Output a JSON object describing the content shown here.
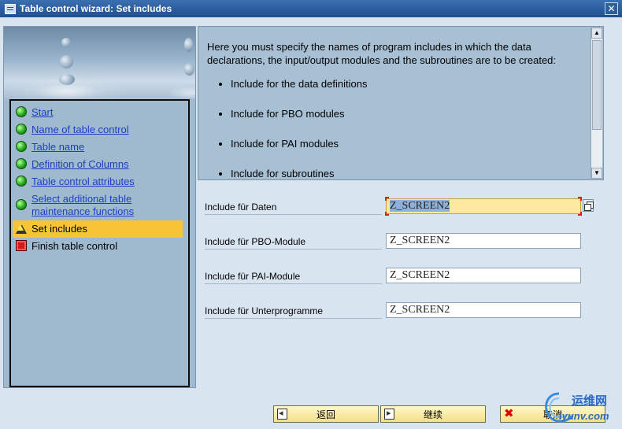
{
  "window": {
    "title": "Table control wizard: Set includes",
    "close_symbol": "✕"
  },
  "steps": [
    {
      "label": "Start",
      "status": "done",
      "icon": "green-light-icon"
    },
    {
      "label": "Name of table control",
      "status": "done",
      "icon": "green-light-icon"
    },
    {
      "label": "Table name",
      "status": "done",
      "icon": "green-light-icon"
    },
    {
      "label": "Definition of Columns",
      "status": "done",
      "icon": "green-light-icon"
    },
    {
      "label": "Table control attributes",
      "status": "done",
      "icon": "green-light-icon"
    },
    {
      "label": "Select additional table maintenance functions",
      "status": "done",
      "icon": "green-light-icon"
    },
    {
      "label": "Set includes",
      "status": "current",
      "icon": "warning-triangle-icon"
    },
    {
      "label": "Finish table control",
      "status": "pending",
      "icon": "red-square-icon"
    }
  ],
  "info": {
    "intro": "Here you must specify the names of program includes in which the data declarations, the input/output modules and the subroutines are to be created:",
    "bullets": [
      "Include for the data definitions",
      "Include for PBO modules",
      "Include for PAI modules",
      "Include for subroutines"
    ]
  },
  "form": {
    "fields": [
      {
        "label": "Include für Daten",
        "value": "Z_SCREEN2"
      },
      {
        "label": "Include für PBO-Module",
        "value": "Z_SCREEN2"
      },
      {
        "label": "Include für PAI-Module",
        "value": "Z_SCREEN2"
      },
      {
        "label": "Include für Unterprogramme",
        "value": "Z_SCREEN2"
      }
    ]
  },
  "buttons": {
    "back": "返回",
    "continue": "继续",
    "cancel": "取消"
  },
  "watermark": {
    "line1": "运维网",
    "line2": "iyunv.com"
  },
  "colors": {
    "titlebar": "#1f4f8f",
    "panel": "#9fb9cf",
    "link": "#1d3fc4",
    "active_step": "#f6c435",
    "button": "#f4e088"
  }
}
